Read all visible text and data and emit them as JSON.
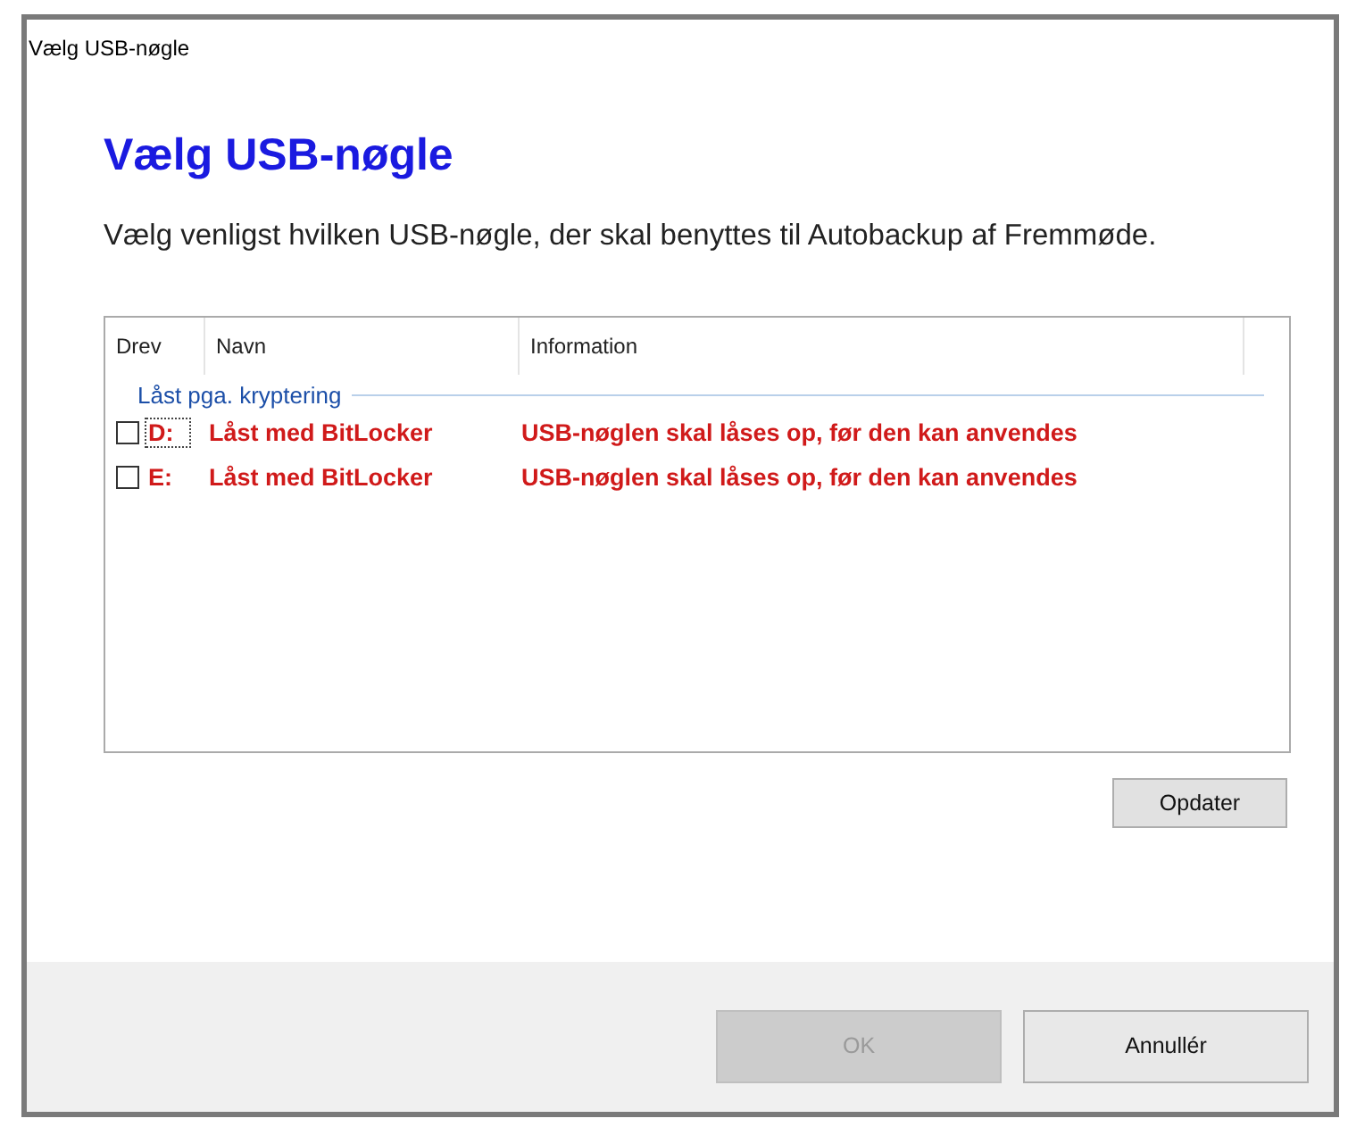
{
  "window": {
    "title": "Vælg USB-nøgle"
  },
  "heading": "Vælg USB-nøgle",
  "description": "Vælg venligst hvilken USB-nøgle, der skal benyttes til Autobackup af Fremmøde.",
  "list": {
    "columns": [
      "Drev",
      "Navn",
      "Information"
    ],
    "groups": [
      {
        "title": "Låst pga. kryptering",
        "items": [
          {
            "drive": "D:",
            "name": "Låst med BitLocker",
            "information": "USB-nøglen skal låses op, før den kan anvendes",
            "checked": false,
            "focused": true
          },
          {
            "drive": "E:",
            "name": "Låst med BitLocker",
            "information": "USB-nøglen skal låses op, før den kan anvendes",
            "checked": false,
            "focused": false
          }
        ]
      }
    ]
  },
  "refresh_button": "Opdater",
  "buttons": [
    {
      "label": "OK",
      "disabled": true
    },
    {
      "label": "Annullér",
      "disabled": false
    }
  ]
}
